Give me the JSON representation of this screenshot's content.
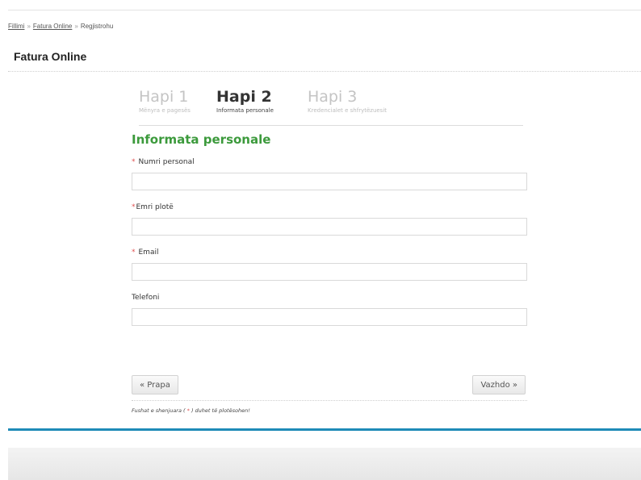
{
  "breadcrumb": {
    "items": [
      "Fillimi",
      "Fatura Online",
      "Regjistrohu"
    ],
    "separator": "»"
  },
  "page_title": "Fatura Online",
  "steps": [
    {
      "title": "Hapi 1",
      "subtitle": "Mënyra e pagesës",
      "active": false
    },
    {
      "title": "Hapi 2",
      "subtitle": "Informata personale",
      "active": true
    },
    {
      "title": "Hapi 3",
      "subtitle": "Kredencialet e shfrytëzuesit",
      "active": false
    }
  ],
  "form": {
    "section_title": "Informata personale",
    "fields": [
      {
        "label": "Numri personal",
        "required": true,
        "value": ""
      },
      {
        "label": "Emri plotë",
        "required": true,
        "value": ""
      },
      {
        "label": "Email",
        "required": true,
        "value": ""
      },
      {
        "label": "Telefoni",
        "required": false,
        "value": ""
      }
    ],
    "required_marker": "*",
    "back_button": "« Prapa",
    "next_button": "Vazhdo »",
    "note_before": "Fushat e shenjuara ( ",
    "note_marker": "*",
    "note_after": " ) duhet të plotësohen!"
  },
  "colors": {
    "accent_green": "#3c9a3c",
    "required_red": "#e05050",
    "footer_blue": "#1f8bb7"
  }
}
